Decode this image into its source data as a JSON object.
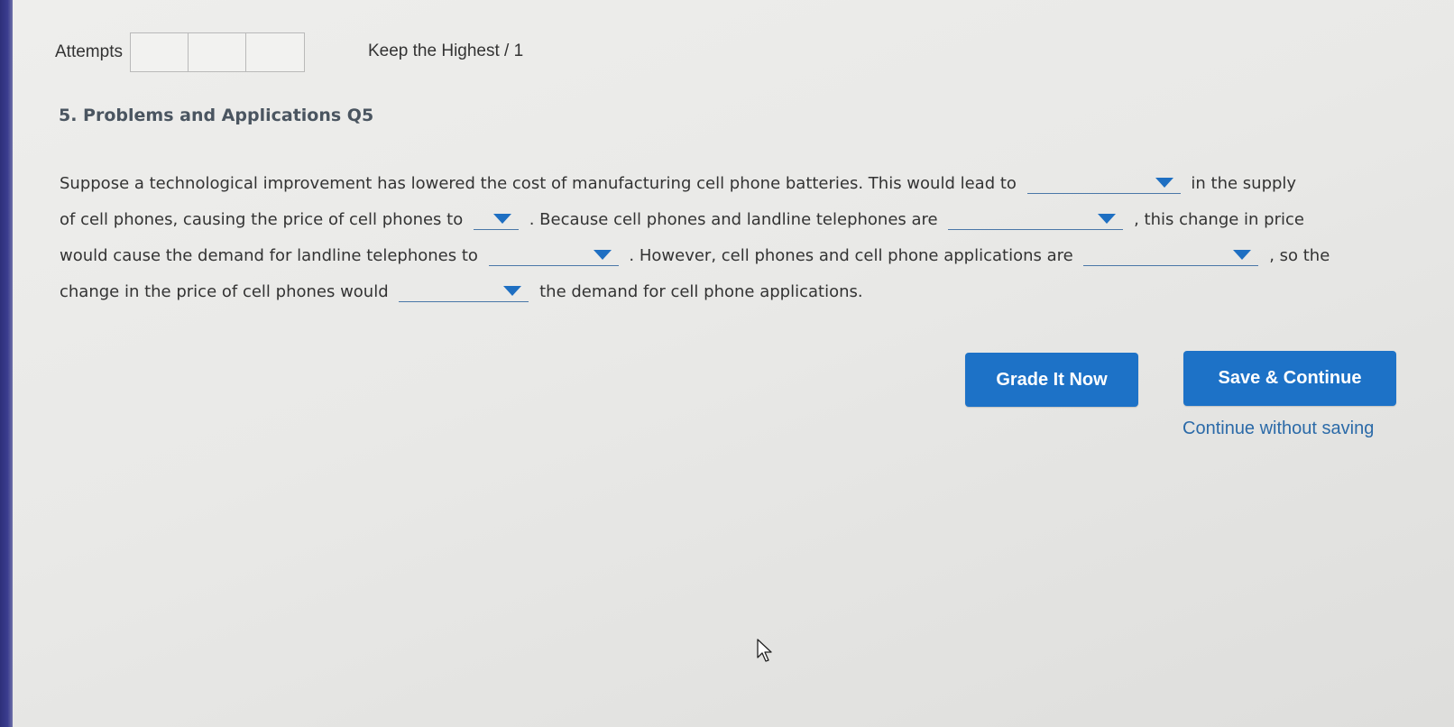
{
  "attempts": {
    "label": "Attempts",
    "slots": 3
  },
  "keep_label": "Keep the Highest / 1",
  "question": {
    "title": "5. Problems and Applications Q5",
    "segments": {
      "s1": "Suppose a technological improvement has lowered the cost of manufacturing cell phone batteries. This would lead to",
      "s2": "in the supply",
      "s3": "of cell phones, causing the price of cell phones to",
      "s4": ". Because cell phones and landline telephones are",
      "s5": ", this change in price",
      "s6": "would cause the demand for landline telephones to",
      "s7": ". However, cell phones and cell phone applications are",
      "s8": ", so the",
      "s9": "change in the price of cell phones would",
      "s10": "the demand for cell phone applications."
    },
    "dropdowns": [
      {
        "id": "dd1",
        "selected": ""
      },
      {
        "id": "dd2",
        "selected": ""
      },
      {
        "id": "dd3",
        "selected": ""
      },
      {
        "id": "dd4",
        "selected": ""
      },
      {
        "id": "dd5",
        "selected": ""
      },
      {
        "id": "dd6",
        "selected": ""
      }
    ]
  },
  "buttons": {
    "grade": "Grade It Now",
    "save": "Save & Continue",
    "continue_link": "Continue without saving"
  },
  "colors": {
    "button_blue": "#1d72c7",
    "link_blue": "#2b6aa8",
    "dropdown_arrow": "#1e6fc2"
  },
  "icons": {
    "dropdown": "caret-down-icon",
    "cursor": "mouse-pointer-icon"
  }
}
